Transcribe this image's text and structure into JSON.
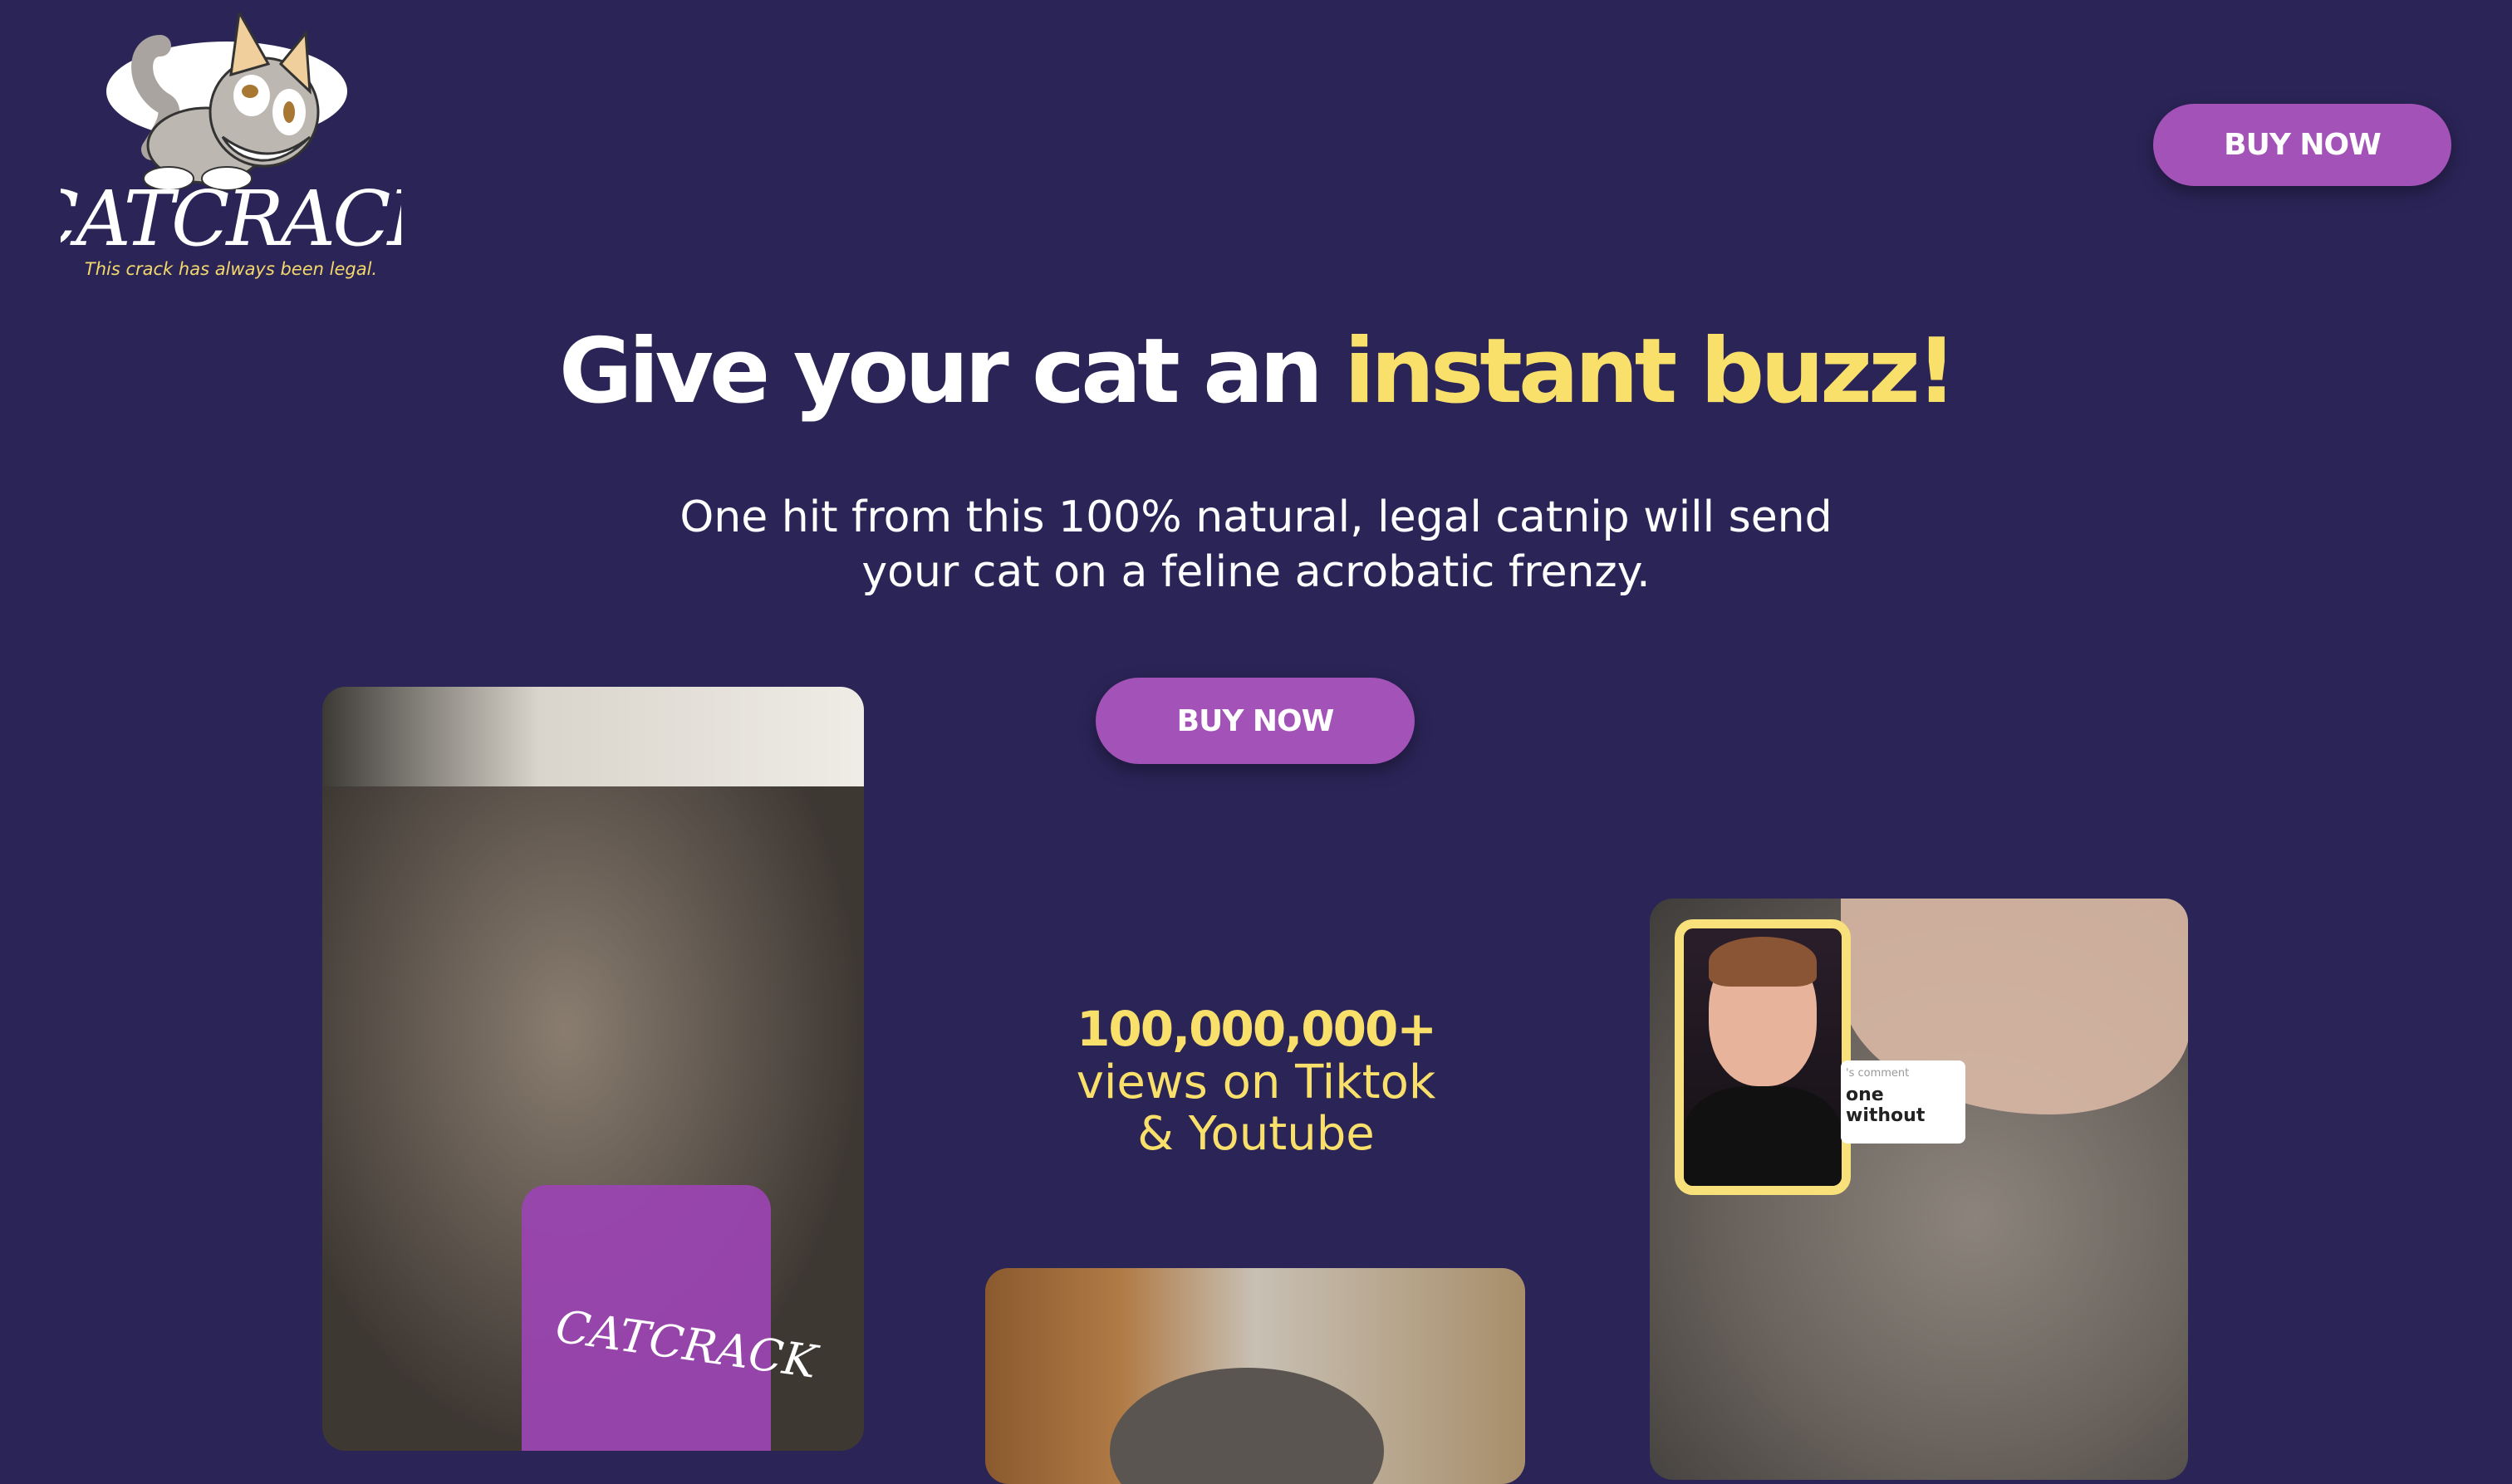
{
  "header": {
    "logo": {
      "brand": "CATCRACK",
      "tagline": "This crack has always been legal."
    },
    "buy_now_label": "BUY NOW"
  },
  "hero": {
    "headline": "Give your cat an",
    "headline_highlight": "instant buzz!",
    "subtext": "One hit from this 100% natural, legal catnip will send your cat on a feline acrobatic frenzy.",
    "buy_now_label": "BUY NOW"
  },
  "stats": {
    "count": "100,000,000+",
    "line1": "views on Tiktok",
    "line2": "& Youtube"
  },
  "videos": {
    "left_jar_label": "CATCRACK",
    "right_comment_prefix": "'s comment",
    "right_comment_text": "one without"
  },
  "colors": {
    "background": "#2b2457",
    "button": "#a352b8",
    "accent": "#f8e06a"
  }
}
